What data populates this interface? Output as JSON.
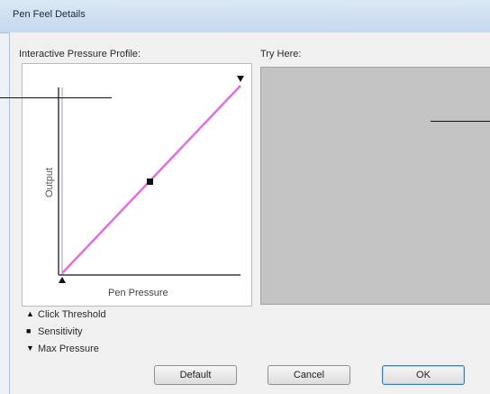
{
  "window": {
    "title": "Pen Feel Details"
  },
  "sections": {
    "profile_label": "Interactive Pressure Profile:",
    "try_label": "Try Here:"
  },
  "graph": {
    "y_axis_label": "Output",
    "x_axis_label": "Pen Pressure",
    "line_color": "#e06ee0",
    "axis_color": "#3a3a3a"
  },
  "legend": {
    "items": [
      {
        "icon": "triangle-up-icon",
        "label": "Click Threshold"
      },
      {
        "icon": "square-icon",
        "label": "Sensitivity"
      },
      {
        "icon": "triangle-down-icon",
        "label": "Max Pressure"
      }
    ]
  },
  "buttons": {
    "default_label": "Default",
    "cancel_label": "Cancel",
    "ok_label": "OK"
  },
  "colors": {
    "try_area": "#c3c3c3",
    "titlebar": "#c4d8ee"
  }
}
